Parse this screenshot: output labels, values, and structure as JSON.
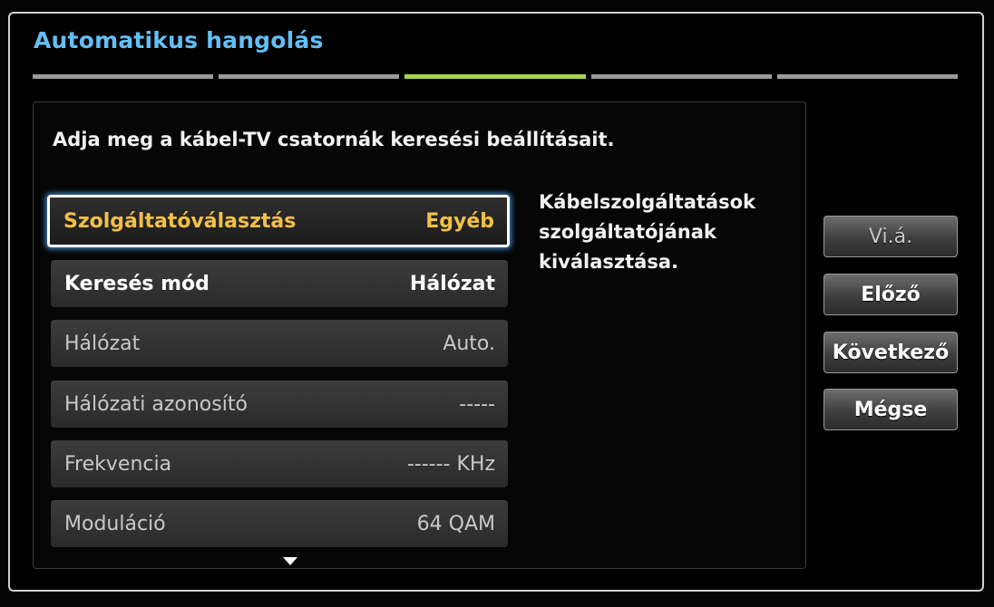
{
  "window": {
    "title": "Automatikus hangolás"
  },
  "progress": {
    "step_count": 5,
    "current_step": 3
  },
  "instruction": "Adja meg a kábel-TV csatornák keresési beállításait.",
  "settings": [
    {
      "label": "Szolgáltatóválasztás",
      "value": "Egyéb",
      "state": "focused"
    },
    {
      "label": "Keresés mód",
      "value": "Hálózat",
      "state": "active"
    },
    {
      "label": "Hálózat",
      "value": "Auto.",
      "state": "disabled"
    },
    {
      "label": "Hálózati azonosító",
      "value": "-----",
      "state": "disabled"
    },
    {
      "label": "Frekvencia",
      "value": "------ KHz",
      "state": "disabled"
    },
    {
      "label": "Moduláció",
      "value": "64 QAM",
      "state": "disabled"
    }
  ],
  "help_text": "Kábelszolgáltatások szolgáltatójának kiválasztása.",
  "buttons": {
    "start": "Vi.á.",
    "previous": "Előző",
    "next": "Következő",
    "cancel": "Mégse"
  },
  "colors": {
    "title": "#63bff5",
    "focused_text": "#f1c048",
    "active_step": "#a6d54a"
  }
}
